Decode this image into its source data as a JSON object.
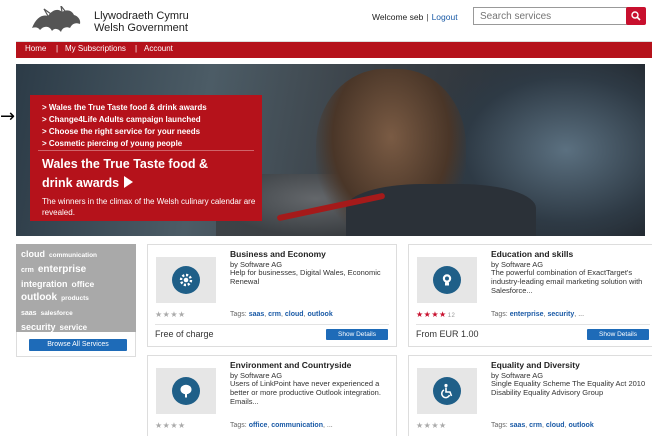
{
  "header": {
    "brand_line1": "Llywodraeth Cymru",
    "brand_line2": "Welsh Government",
    "welcome": "Welcome seb",
    "separator": "|",
    "logout": "Logout",
    "search_placeholder": "Search services"
  },
  "nav": {
    "home": "Home",
    "subscriptions": "My Subscriptions",
    "account": "Account",
    "separator": "|"
  },
  "promo": {
    "items": [
      "> Wales the True Taste food & drink awards",
      "> Change4Life Adults campaign launched",
      "> Choose the right service for your needs",
      "> Cosmetic piercing of young people"
    ],
    "title": "Wales the True Taste food & drink awards",
    "description": "The winners in the climax of the Welsh culinary calendar are revealed."
  },
  "tag_cloud": {
    "rows": [
      [
        "cloud",
        "communication"
      ],
      [
        "crm",
        "enterprise"
      ],
      [
        "integration",
        "office"
      ],
      [
        "outlook",
        "products"
      ],
      [
        "saas",
        "salesforce"
      ],
      [
        "security",
        "service"
      ],
      [
        "software",
        "solutions"
      ]
    ],
    "browse_label": "Browse All Services"
  },
  "cards": [
    {
      "title": "Business and Economy",
      "by": "by Software AG",
      "description": "Help for businesses, Digital Wales, Economic Renewal",
      "rating": 0,
      "rating_count": "",
      "tags_label": "Tags:",
      "tags": [
        "saas",
        "crm",
        "cloud",
        "outlook"
      ],
      "price": "Free of charge",
      "details_label": "Show Details",
      "icon": "gear-icon"
    },
    {
      "title": "Education and skills",
      "by": "by Software AG",
      "description": "The powerful combination of ExactTarget's industry-leading email marketing solution with Salesforce...",
      "rating": 4,
      "rating_count": "12",
      "tags_label": "Tags:",
      "tags": [
        "enterprise",
        "security",
        "..."
      ],
      "price": "From EUR 1.00",
      "details_label": "Show Details",
      "icon": "lightbulb-icon"
    },
    {
      "title": "Environment and Countryside",
      "by": "by Software AG",
      "description": "Users of LinkPoint have never experienced a better or more productive Outlook integration. Emails...",
      "rating": 0,
      "rating_count": "",
      "tags_label": "Tags:",
      "tags": [
        "office",
        "communication",
        "..."
      ],
      "icon": "tree-icon"
    },
    {
      "title": "Equality and Diversity",
      "by": "by Software AG",
      "description": "Single Equality Scheme The Equality Act 2010 Disability Equality Advisory Group",
      "rating": 0,
      "rating_count": "",
      "tags_label": "Tags:",
      "tags": [
        "saas",
        "crm",
        "cloud",
        "outlook"
      ],
      "icon": "wheelchair-icon"
    }
  ],
  "colors": {
    "brand_red": "#b5121b",
    "button_blue": "#1e6bb8",
    "icon_blue": "#1f5f88",
    "tag_link": "#1a5aa6"
  }
}
